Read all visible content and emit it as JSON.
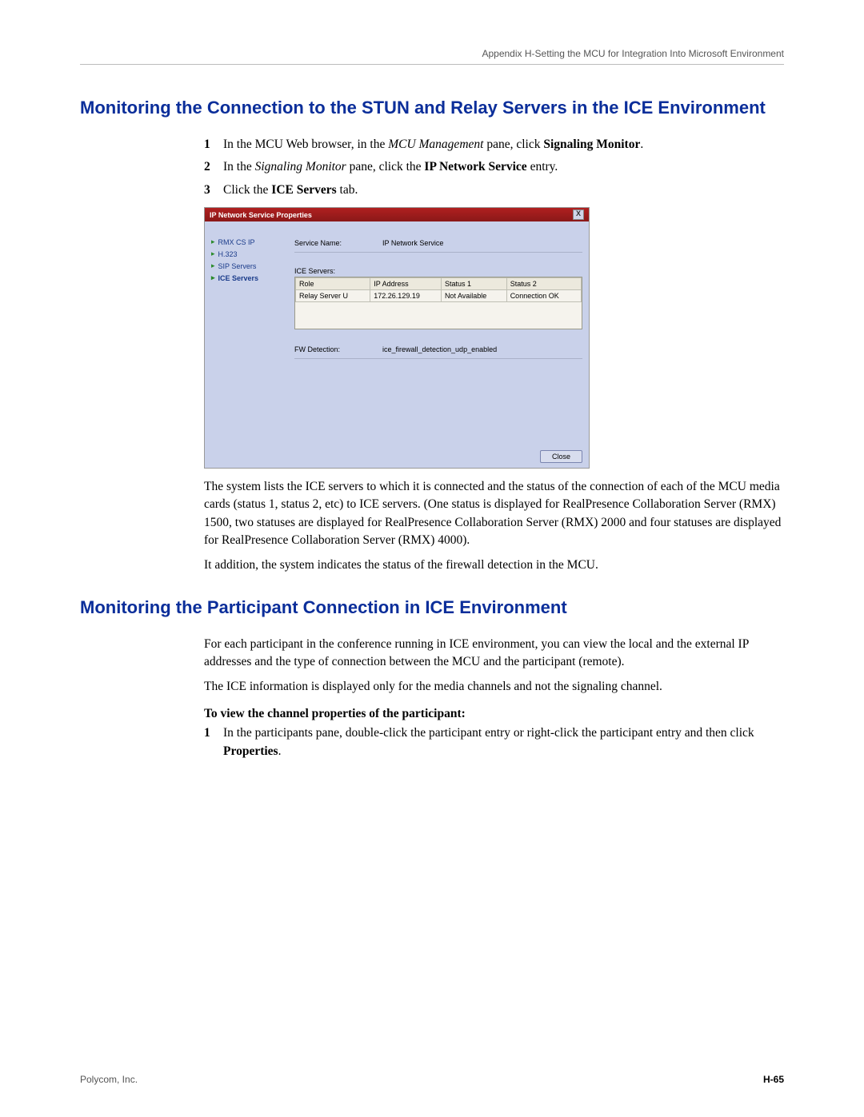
{
  "header": "Appendix H-Setting the MCU for Integration Into Microsoft Environment",
  "title1": "Monitoring the Connection to the STUN and Relay Servers in the ICE Environment",
  "steps1": {
    "s1_a": "In the MCU Web browser, in the ",
    "s1_b": "MCU Management",
    "s1_c": " pane, click ",
    "s1_d": "Signaling Monitor",
    "s1_e": ".",
    "s2_a": "In the ",
    "s2_b": "Signaling Monitor",
    "s2_c": " pane, click the ",
    "s2_d": "IP Network Service",
    "s2_e": " entry.",
    "s3_a": "Click the ",
    "s3_b": "ICE Servers",
    "s3_c": " tab."
  },
  "dialog": {
    "title": "IP Network Service Properties",
    "close": "X",
    "nav": {
      "n1": "RMX CS IP",
      "n2": "H.323",
      "n3": "SIP Servers",
      "n4": "ICE Servers"
    },
    "serviceNameLabel": "Service Name:",
    "serviceNameValue": "IP Network Service",
    "iceServersLabel": "ICE Servers:",
    "table": {
      "h1": "Role",
      "h2": "IP Address",
      "h3": "Status 1",
      "h4": "Status 2",
      "r1c1": "Relay Server U",
      "r1c2": "172.26.129.19",
      "r1c3": "Not Available",
      "r1c4": "Connection OK"
    },
    "fwLabel": "FW Detection:",
    "fwValue": "ice_firewall_detection_udp_enabled",
    "closeBtn": "Close"
  },
  "para1": "The system lists the ICE servers to which it is connected and the status of the connection of each of the MCU media cards (status 1, status 2, etc) to ICE servers. (One status is displayed for RealPresence Collaboration Server (RMX) 1500, two statuses are displayed for RealPresence Collaboration Server (RMX) 2000 and four statuses are displayed for RealPresence Collaboration Server (RMX) 4000).",
  "para2": "It addition, the system indicates the status of the firewall detection in the MCU.",
  "title2": "Monitoring the Participant Connection in ICE Environment",
  "para3": "For each participant in the conference running in ICE environment, you can view the local and the external IP addresses and the type of connection between the MCU and the participant (remote).",
  "para4": "The ICE information is displayed only for the media channels and not the signaling channel.",
  "subhead": "To view the channel properties of the participant:",
  "steps2": {
    "s1_a": "In the participants pane, double-click the participant entry or right-click the participant entry and then click ",
    "s1_b": "Properties",
    "s1_c": "."
  },
  "footer": {
    "left": "Polycom, Inc.",
    "right": "H-65"
  }
}
